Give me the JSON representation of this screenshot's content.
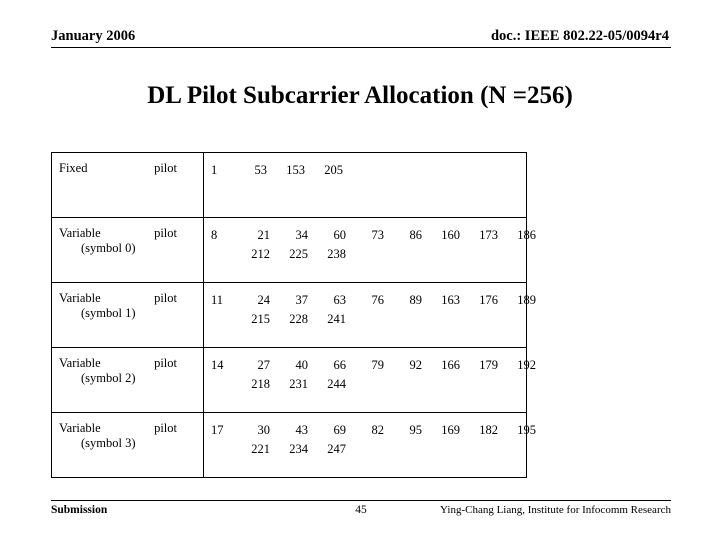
{
  "header": {
    "date": "January 2006",
    "docref": "doc.: IEEE 802.22-05/0094r4"
  },
  "title": "DL Pilot Subcarrier Allocation (N =256)",
  "table": {
    "rows": [
      {
        "label_line1": "Fixed pilot",
        "label_line2": "",
        "values_line1": [
          "1",
          "53",
          "153",
          "205"
        ],
        "values_line2": []
      },
      {
        "label_line1": "Variable pilot",
        "label_line2": "(symbol 0)",
        "values_line1": [
          "8",
          "21",
          "34",
          "60",
          "73",
          "86",
          "160",
          "173",
          "186"
        ],
        "values_line2": [
          "212",
          "225",
          "238"
        ]
      },
      {
        "label_line1": "Variable pilot",
        "label_line2": "(symbol 1)",
        "values_line1": [
          "11",
          "24",
          "37",
          "63",
          "76",
          "89",
          "163",
          "176",
          "189"
        ],
        "values_line2": [
          "215",
          "228",
          "241"
        ]
      },
      {
        "label_line1": "Variable pilot",
        "label_line2": "(symbol 2)",
        "values_line1": [
          "14",
          "27",
          "40",
          "66",
          "79",
          "92",
          "166",
          "179",
          "192"
        ],
        "values_line2": [
          "218",
          "231",
          "244"
        ]
      },
      {
        "label_line1": "Variable pilot",
        "label_line2": "(symbol 3)",
        "values_line1": [
          "17",
          "30",
          "43",
          "69",
          "82",
          "95",
          "169",
          "182",
          "195"
        ],
        "values_line2": [
          "221",
          "234",
          "247"
        ]
      }
    ]
  },
  "footer": {
    "submission": "Submission",
    "page": "45",
    "author": "Ying-Chang Liang, Institute for Infocomm Research"
  }
}
